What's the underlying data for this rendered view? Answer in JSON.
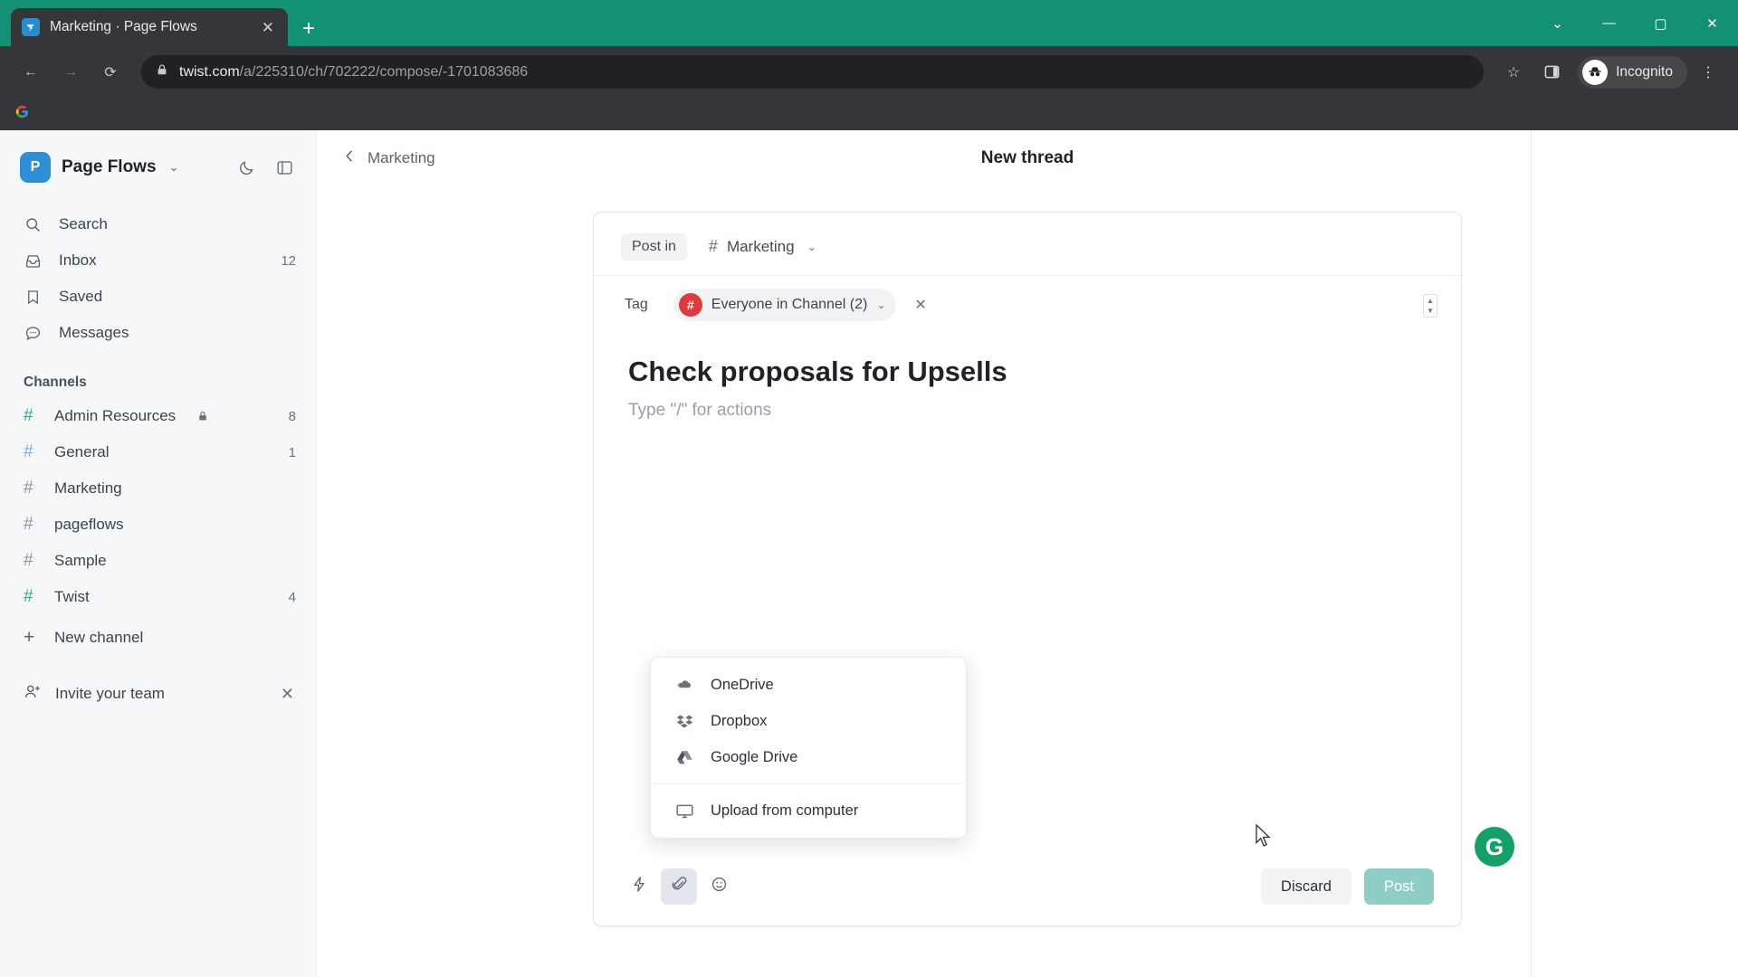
{
  "browser": {
    "tab": {
      "title": "Marketing · Page Flows",
      "favicon": "twist-favicon",
      "close": "✕"
    },
    "new_tab": "+",
    "window": {
      "minimize": "—",
      "maximize": "▢",
      "close": "✕",
      "chevron": "⌄"
    },
    "nav": {
      "back": "←",
      "forward": "→",
      "reload": "⟳"
    },
    "url": {
      "lock": "lock-icon",
      "domain": "twist.com",
      "path": "/a/225310/ch/702222/compose/-1701083686"
    },
    "actions": {
      "bookmark": "☆",
      "side_panel": "side-panel-icon",
      "menu": "⋮"
    },
    "profile": {
      "label": "Incognito",
      "icon": "incognito-icon"
    }
  },
  "sidebar": {
    "workspace": {
      "initial": "P",
      "name": "Page Flows",
      "caret": "⌄"
    },
    "header_actions": [
      {
        "name": "dark-mode-toggle",
        "icon": "moon-icon"
      },
      {
        "name": "panel-toggle",
        "icon": "panel-icon"
      }
    ],
    "nav": [
      {
        "label": "Search",
        "icon": "search-icon",
        "badge": ""
      },
      {
        "label": "Inbox",
        "icon": "inbox-icon",
        "badge": "12"
      },
      {
        "label": "Saved",
        "icon": "bookmark-icon",
        "badge": ""
      },
      {
        "label": "Messages",
        "icon": "messages-icon",
        "badge": ""
      }
    ],
    "channels_title": "Channels",
    "channels": [
      {
        "label": "Admin Resources",
        "badge": "8",
        "locked": true,
        "hash_color": "#3aa394"
      },
      {
        "label": "General",
        "badge": "1",
        "locked": false,
        "hash_color": "#7fa8d6"
      },
      {
        "label": "Marketing",
        "badge": "",
        "locked": false,
        "hash_color": "#8b9199"
      },
      {
        "label": "pageflows",
        "badge": "",
        "locked": false,
        "hash_color": "#8b9199"
      },
      {
        "label": "Sample",
        "badge": "",
        "locked": false,
        "hash_color": "#8b9199"
      },
      {
        "label": "Twist",
        "badge": "4",
        "locked": false,
        "hash_color": "#3aa394"
      }
    ],
    "new_channel": {
      "label": "New channel",
      "icon": "plus-icon"
    },
    "invite": {
      "label": "Invite your team",
      "icon": "add-person-icon",
      "dismiss": "✕"
    }
  },
  "main": {
    "back": {
      "label": "Marketing",
      "icon": "chevron-left-icon"
    },
    "title": "New thread"
  },
  "compose": {
    "post_in_label": "Post in",
    "channel": {
      "hash": "#",
      "name": "Marketing",
      "caret": "⌄"
    },
    "tag_label": "Tag",
    "tag": {
      "avatar_hash": "#",
      "name": "Everyone in Channel (2)",
      "caret": "⌄",
      "remove": "✕"
    },
    "thread_title": "Check proposals for Upsells",
    "body_placeholder": "Type \"/\" for actions",
    "toolbar": [
      {
        "name": "quick-actions-button",
        "icon": "lightning-icon",
        "active": false
      },
      {
        "name": "attachment-button",
        "icon": "paperclip-icon",
        "active": true
      },
      {
        "name": "emoji-button",
        "icon": "emoji-icon",
        "active": false
      }
    ],
    "discard_label": "Discard",
    "post_label": "Post"
  },
  "attach_menu": {
    "items": [
      {
        "label": "OneDrive",
        "icon": "onedrive-icon"
      },
      {
        "label": "Dropbox",
        "icon": "dropbox-icon"
      },
      {
        "label": "Google Drive",
        "icon": "googledrive-icon"
      }
    ],
    "upload": {
      "label": "Upload from computer",
      "icon": "monitor-icon"
    }
  },
  "grammarly": {
    "label": "G"
  },
  "colors": {
    "tabstrip": "#149174",
    "chrome": "#35363a",
    "omnibox": "#202124",
    "sidebar": "#f6f7f9",
    "accent_teal": "#3aa394",
    "post_button": "#8fcec4",
    "tag_red": "#dc3c3c",
    "grammarly_green": "#15a06a"
  }
}
